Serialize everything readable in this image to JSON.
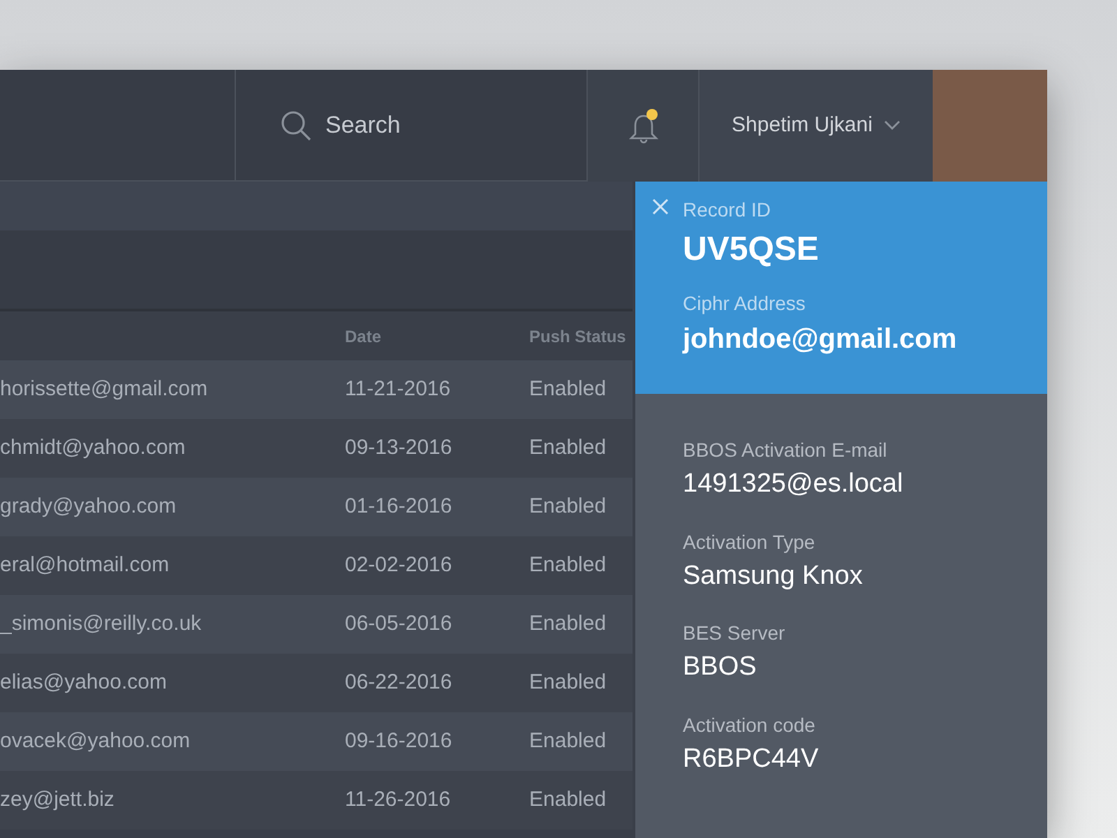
{
  "header": {
    "search": {
      "placeholder": "Search"
    },
    "notifications": {
      "unread": true
    },
    "user": {
      "name": "Shpetim Ujkani"
    }
  },
  "table": {
    "columns": [
      "Date",
      "Push Status"
    ],
    "rows": [
      {
        "column_1": "horissette@gmail.com",
        "date": "11-21-2016",
        "push_status": "Enabled"
      },
      {
        "column_1": "chmidt@yahoo.com",
        "date": "09-13-2016",
        "push_status": "Enabled"
      },
      {
        "column_1": "grady@yahoo.com",
        "date": "01-16-2016",
        "push_status": "Enabled"
      },
      {
        "column_1": "eral@hotmail.com",
        "date": "02-02-2016",
        "push_status": "Enabled"
      },
      {
        "column_1": "_simonis@reilly.co.uk",
        "date": "06-05-2016",
        "push_status": "Enabled"
      },
      {
        "column_1": "elias@yahoo.com",
        "date": "06-22-2016",
        "push_status": "Enabled"
      },
      {
        "column_1": "ovacek@yahoo.com",
        "date": "09-16-2016",
        "push_status": "Enabled"
      },
      {
        "column_1": "zey@jett.biz",
        "date": "11-26-2016",
        "push_status": "Enabled"
      }
    ]
  },
  "detail_panel": {
    "highlight_fields": [
      {
        "label": "Record ID",
        "value": "UV5QSE"
      },
      {
        "label": "Ciphr Address",
        "value": "johndoe@gmail.com"
      }
    ],
    "fields": [
      {
        "label": "BBOS Activation E-mail",
        "value": "1491325@es.local"
      },
      {
        "label": "Activation Type",
        "value": "Samsung Knox"
      },
      {
        "label": "BES Server",
        "value": "BBOS"
      },
      {
        "label": "Activation code",
        "value": "R6BPC44V"
      }
    ]
  }
}
